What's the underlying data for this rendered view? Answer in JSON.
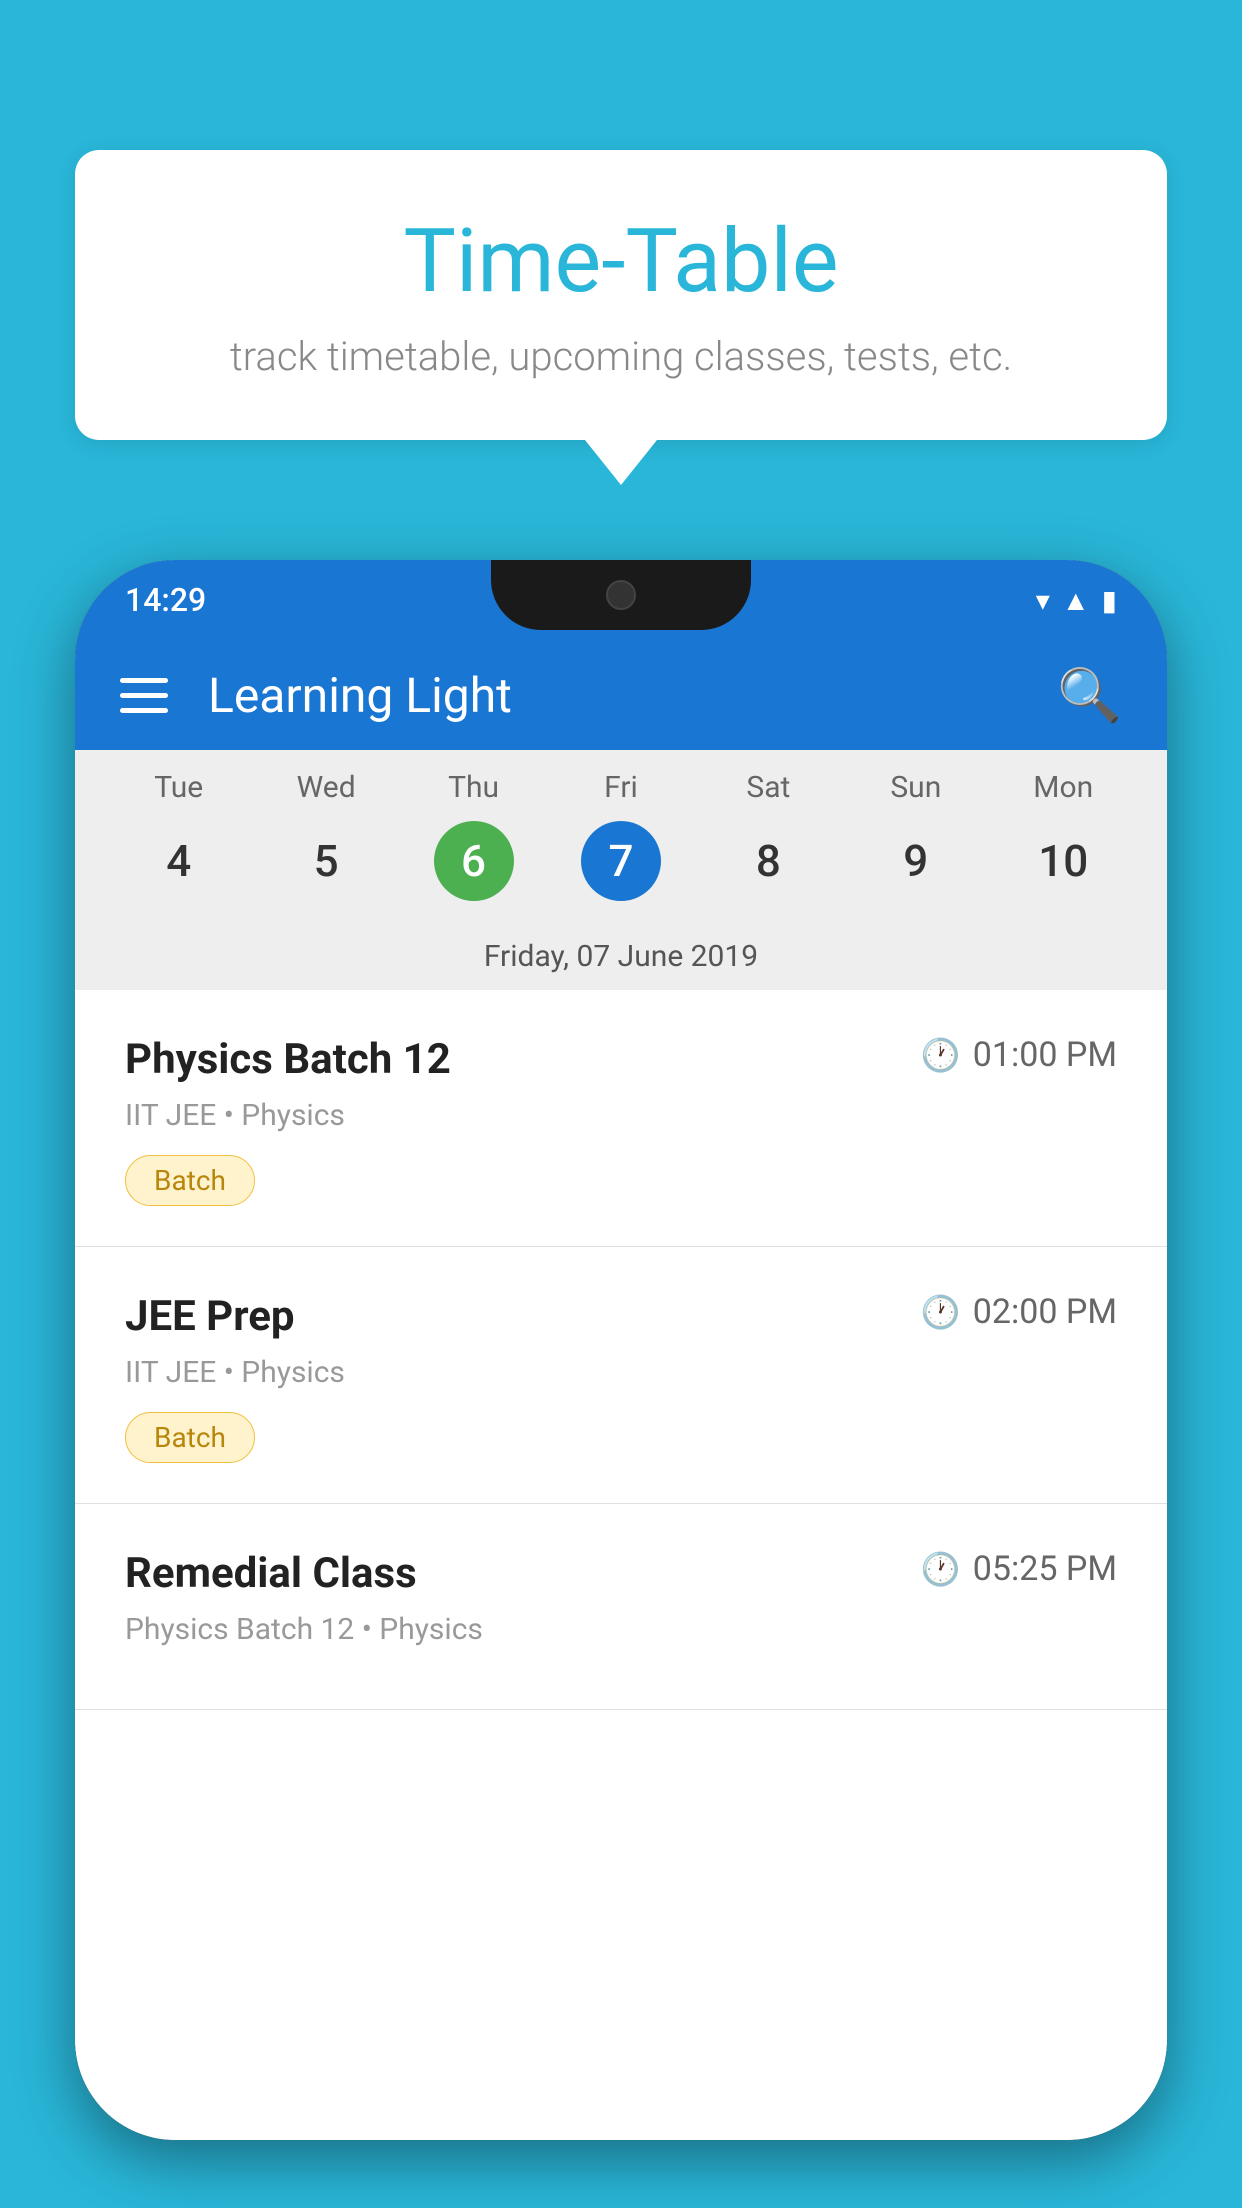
{
  "background_color": "#29B6D8",
  "bubble": {
    "title": "Time-Table",
    "subtitle": "track timetable, upcoming classes, tests, etc."
  },
  "status_bar": {
    "time": "14:29"
  },
  "app_bar": {
    "title": "Learning Light",
    "menu_icon_label": "menu",
    "search_icon_label": "search"
  },
  "calendar": {
    "selected_date_label": "Friday, 07 June 2019",
    "days": [
      {
        "name": "Tue",
        "num": "4",
        "state": "normal"
      },
      {
        "name": "Wed",
        "num": "5",
        "state": "normal"
      },
      {
        "name": "Thu",
        "num": "6",
        "state": "today"
      },
      {
        "name": "Fri",
        "num": "7",
        "state": "selected"
      },
      {
        "name": "Sat",
        "num": "8",
        "state": "normal"
      },
      {
        "name": "Sun",
        "num": "9",
        "state": "normal"
      },
      {
        "name": "Mon",
        "num": "10",
        "state": "normal"
      }
    ]
  },
  "schedule": {
    "items": [
      {
        "title": "Physics Batch 12",
        "time": "01:00 PM",
        "category": "IIT JEE • Physics",
        "tag": "Batch"
      },
      {
        "title": "JEE Prep",
        "time": "02:00 PM",
        "category": "IIT JEE • Physics",
        "tag": "Batch"
      },
      {
        "title": "Remedial Class",
        "time": "05:25 PM",
        "category": "Physics Batch 12 • Physics",
        "tag": ""
      }
    ]
  }
}
